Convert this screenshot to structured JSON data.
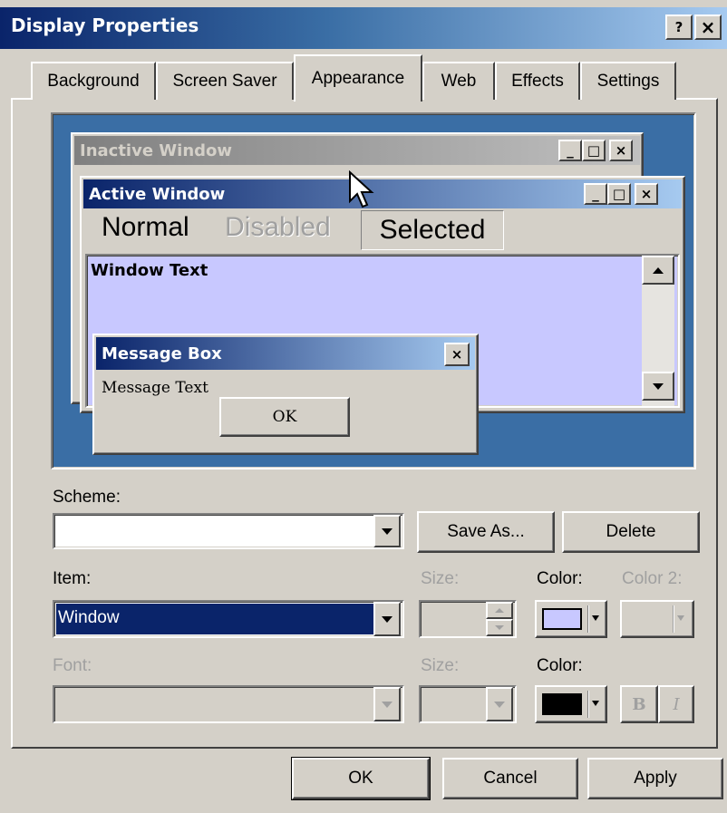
{
  "window": {
    "title": "Display Properties",
    "help_button": "?",
    "close_button": "×"
  },
  "tabs": [
    {
      "label": "Background"
    },
    {
      "label": "Screen Saver"
    },
    {
      "label": "Appearance",
      "selected": true
    },
    {
      "label": "Web"
    },
    {
      "label": "Effects"
    },
    {
      "label": "Settings"
    }
  ],
  "preview": {
    "inactive_title": "Inactive Window",
    "active_title": "Active Window",
    "menu_normal": "Normal",
    "menu_disabled": "Disabled",
    "menu_selected": "Selected",
    "window_text": "Window Text",
    "message_title": "Message Box",
    "message_text": "Message Text",
    "message_ok": "OK",
    "window_color": "#c8c8ff",
    "desktop_color": "#3a6ea5"
  },
  "scheme": {
    "label": "Scheme:",
    "value": "",
    "save_as": "Save As...",
    "delete": "Delete"
  },
  "item": {
    "label": "Item:",
    "value": "Window",
    "size_label": "Size:",
    "color_label": "Color:",
    "color2_label": "Color 2:",
    "color_value": "#c8c8ff"
  },
  "font": {
    "label": "Font:",
    "size_label": "Size:",
    "color_label": "Color:",
    "bold_label": "B",
    "italic_label": "I",
    "color_value": "#000000"
  },
  "buttons": {
    "ok": "OK",
    "cancel": "Cancel",
    "apply": "Apply"
  }
}
